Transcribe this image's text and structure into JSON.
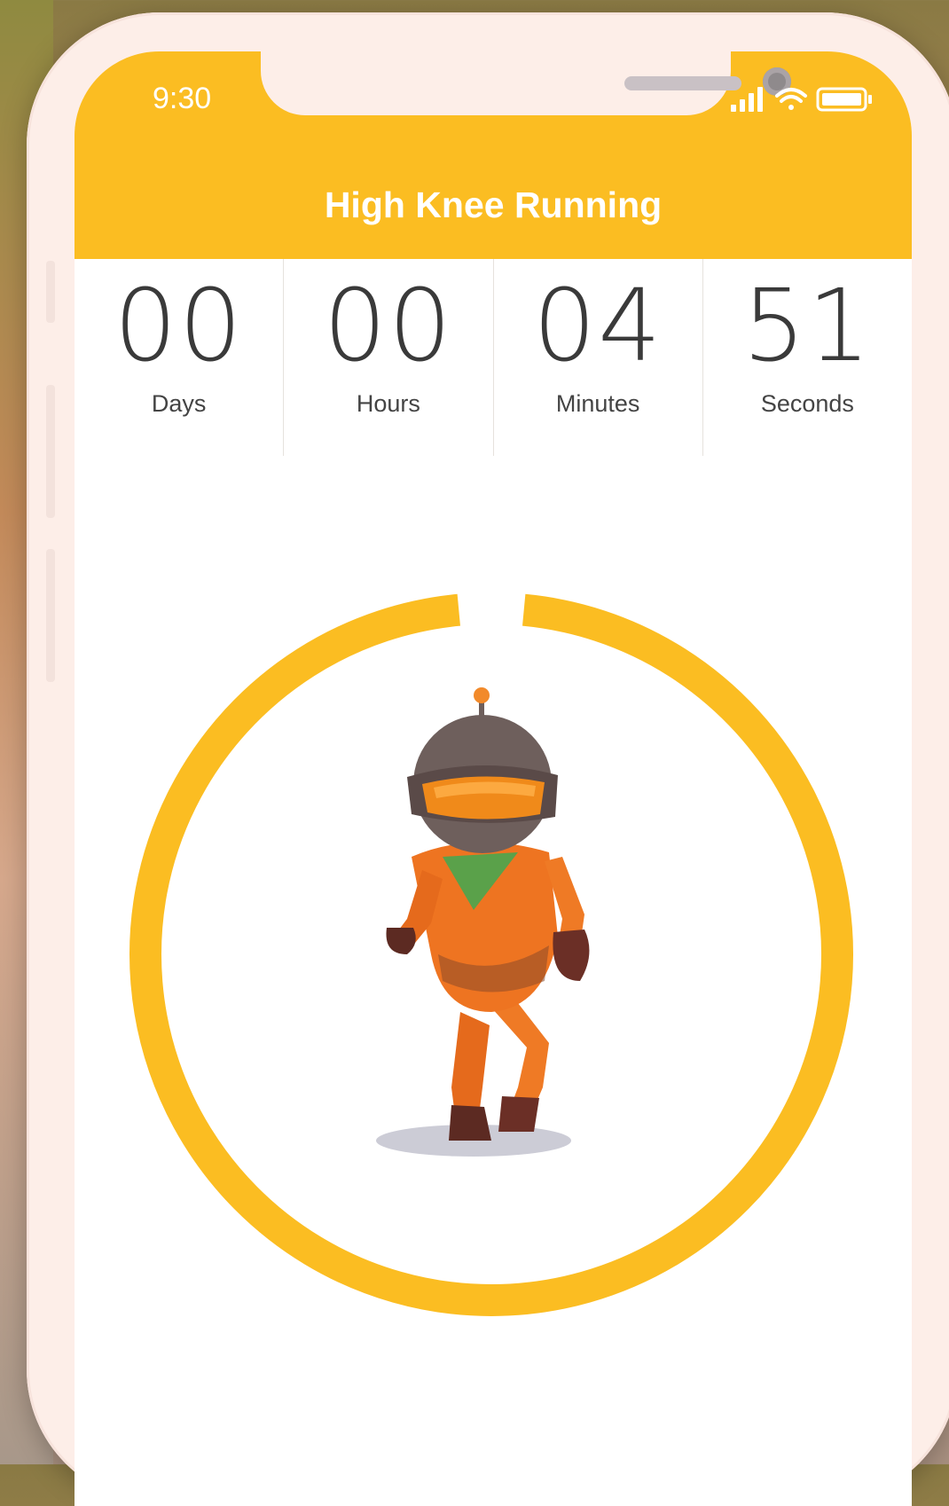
{
  "status_bar": {
    "time": "9:30"
  },
  "header": {
    "title": "High Knee Running"
  },
  "countdown": [
    {
      "value": "00",
      "unit": "Days"
    },
    {
      "value": "00",
      "unit": "Hours"
    },
    {
      "value": "04",
      "unit": "Minutes"
    },
    {
      "value": "51",
      "unit": "Seconds"
    }
  ],
  "progress_ring": {
    "fraction_remaining": 0.97
  },
  "colors": {
    "accent": "#fbbd22",
    "phone_frame": "#fdeee8",
    "text": "#3a3a3a"
  },
  "icons": [
    "signal-icon",
    "wifi-icon",
    "battery-icon"
  ]
}
